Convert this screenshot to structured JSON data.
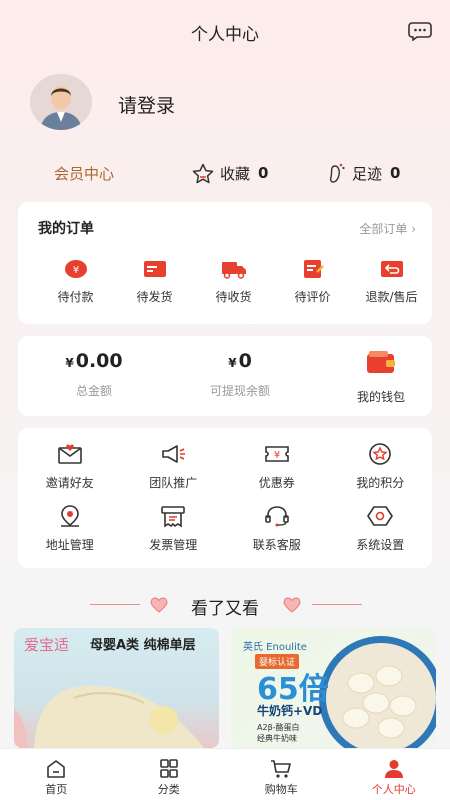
{
  "header": {
    "title": "个人中心",
    "message_icon": "chat-bubble-icon"
  },
  "profile": {
    "login_text": "请登录",
    "avatar_icon": "default-avatar"
  },
  "stats": {
    "vip_label": "会员中心",
    "favorites_label": "收藏",
    "favorites_count": "0",
    "footprint_label": "足迹",
    "footprint_count": "0"
  },
  "orders": {
    "title": "我的订单",
    "all_link": "全部订单",
    "items": [
      {
        "label": "待付款",
        "icon": "wallet-pay-icon"
      },
      {
        "label": "待发货",
        "icon": "package-card-icon"
      },
      {
        "label": "待收货",
        "icon": "truck-icon"
      },
      {
        "label": "待评价",
        "icon": "review-icon"
      },
      {
        "label": "退款/售后",
        "icon": "refund-icon"
      }
    ]
  },
  "wallet": {
    "currency": "¥",
    "total_amount": "0.00",
    "total_label": "总金额",
    "withdraw_amount": "0",
    "withdraw_label": "可提现余额",
    "wallet_label": "我的钱包"
  },
  "services": {
    "items": [
      {
        "label": "邀请好友",
        "icon": "invite-icon"
      },
      {
        "label": "团队推广",
        "icon": "megaphone-icon"
      },
      {
        "label": "优惠券",
        "icon": "coupon-icon"
      },
      {
        "label": "我的积分",
        "icon": "points-icon"
      },
      {
        "label": "地址管理",
        "icon": "location-icon"
      },
      {
        "label": "发票管理",
        "icon": "invoice-icon"
      },
      {
        "label": "联系客服",
        "icon": "headset-icon"
      },
      {
        "label": "系统设置",
        "icon": "settings-icon"
      }
    ]
  },
  "recommend": {
    "title": "看了又看",
    "products": [
      {
        "brand": "爱宝适",
        "title": "母婴A类  纯棉单层"
      },
      {
        "brand": "英氏 Enoulite",
        "cert": "婴标认证",
        "big_text": "65倍",
        "sub_text": "牛奶钙+VD",
        "list": [
          "A2β-酪蛋白",
          "经典牛奶味"
        ]
      }
    ]
  },
  "tabbar": {
    "items": [
      {
        "label": "首页",
        "icon": "home-icon"
      },
      {
        "label": "分类",
        "icon": "category-icon"
      },
      {
        "label": "购物车",
        "icon": "cart-icon"
      },
      {
        "label": "个人中心",
        "icon": "user-icon"
      }
    ],
    "active_index": 3
  },
  "colors": {
    "accent": "#e33b2e",
    "vip": "#a8682e"
  }
}
